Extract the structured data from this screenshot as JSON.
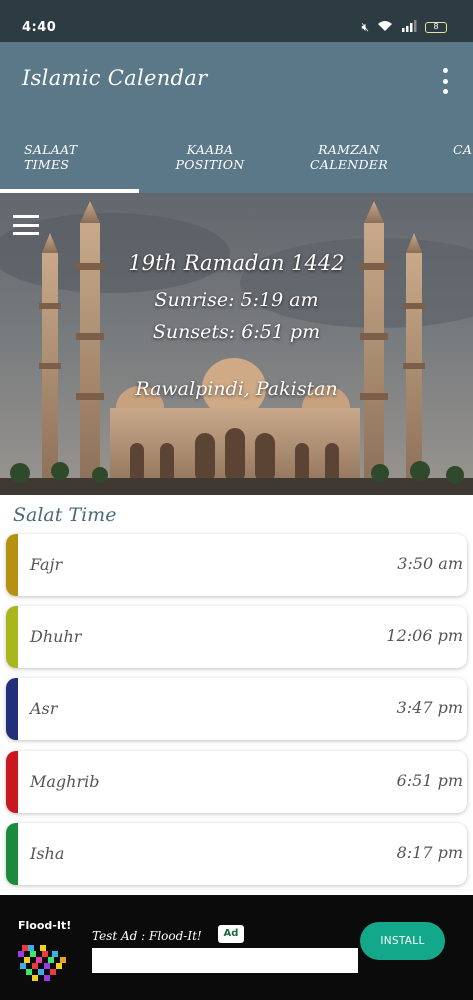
{
  "status_bar": {
    "time": "4:40",
    "battery": "8"
  },
  "app_bar": {
    "title": "Islamic Calendar",
    "menu_icon": "overflow-menu-icon"
  },
  "tabs": [
    {
      "label_line1": "SALAAT TIMES",
      "label_line2": ""
    },
    {
      "label_line1": "KAABA",
      "label_line2": "POSITION"
    },
    {
      "label_line1": "RAMZAN",
      "label_line2": "CALENDER"
    },
    {
      "label_line1": "CA",
      "label_line2": ""
    }
  ],
  "hero": {
    "date": "19th Ramadan 1442",
    "sunrise": "Sunrise: 5:19 am",
    "sunset": "Sunsets: 6:51 pm",
    "location": "Rawalpindi, Pakistan"
  },
  "salat": {
    "title": "Salat Time",
    "prayers": [
      {
        "name": "Fajr",
        "time": "3:50 am",
        "color": "#b8900f"
      },
      {
        "name": "Dhuhr",
        "time": "12:06 pm",
        "color": "#a8b81c"
      },
      {
        "name": "Asr",
        "time": "3:47 pm",
        "color": "#22307a"
      },
      {
        "name": "Maghrib",
        "time": "6:51 pm",
        "color": "#c8191f"
      },
      {
        "name": "Isha",
        "time": "8:17 pm",
        "color": "#1b8a3c"
      }
    ]
  },
  "ad": {
    "logo_title": "Flood-It!",
    "text": "Test Ad : Flood-It!",
    "badge": "Ad",
    "install": "INSTALL",
    "accent": "#14a88a"
  }
}
